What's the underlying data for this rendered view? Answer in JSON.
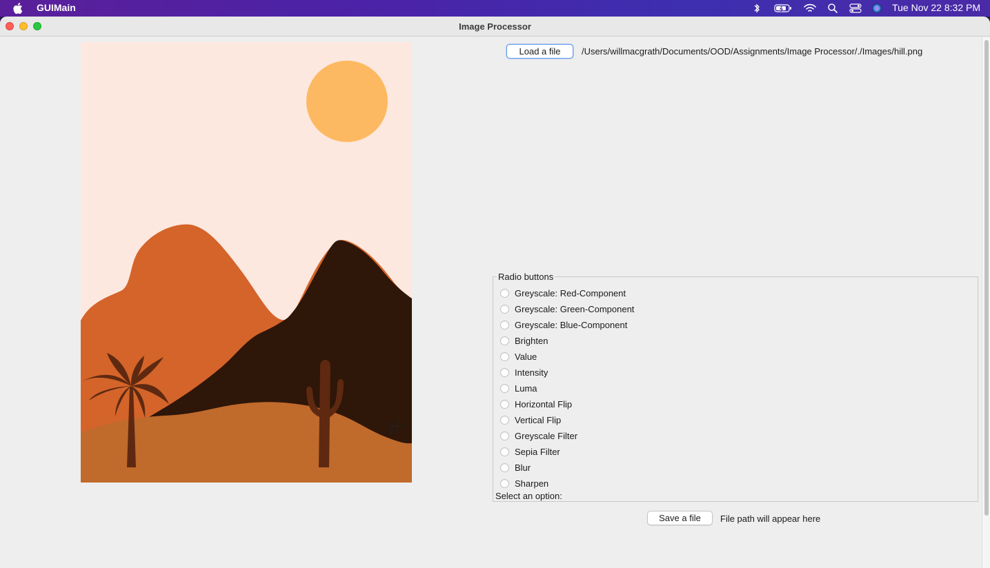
{
  "menubar": {
    "app_name": "GUIMain",
    "clock": "Tue Nov 22  8:32 PM",
    "status_icons": [
      "bluetooth-icon",
      "battery-icon",
      "wifi-icon",
      "spotlight-icon",
      "control-center-icon",
      "siri-icon"
    ]
  },
  "window": {
    "title": "Image Processor"
  },
  "load": {
    "button_label": "Load a file",
    "path": "/Users/willmacgrath/Documents/OOD/Assignments/Image Processor/./Images/hill.png"
  },
  "radio_group": {
    "legend": "Radio buttons",
    "options": [
      "Greyscale: Red-Component",
      "Greyscale: Green-Component",
      "Greyscale: Blue-Component",
      "Brighten",
      "Value",
      "Intensity",
      "Luma",
      "Horizontal Flip",
      "Vertical Flip",
      "Greyscale Filter",
      "Sepia Filter",
      "Blur",
      "Sharpen"
    ],
    "select_label": "Select an option:"
  },
  "save": {
    "button_label": "Save a file",
    "path": "File path will appear here"
  },
  "colors": {
    "sky": "#fde8df",
    "sun": "#fdb961",
    "left_hill": "#d4642a",
    "dark_hill": "#2e1608",
    "sand": "#c06a2c",
    "plant": "#5e2910"
  }
}
